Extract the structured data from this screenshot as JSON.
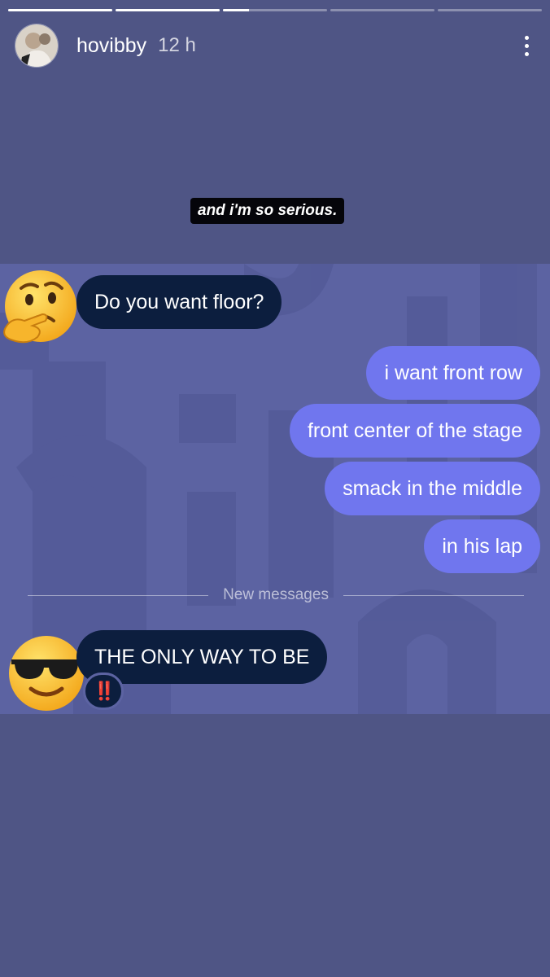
{
  "story": {
    "username": "hovibby",
    "time": "12 h",
    "progress": [
      1,
      1,
      0.25,
      0,
      0
    ]
  },
  "caption": "and i'm so serious.",
  "messages": {
    "incoming_1": "Do you want floor?",
    "outgoing": [
      "i want front row",
      "front center of the stage",
      "smack in the middle",
      "in his lap"
    ],
    "divider_label": "New messages",
    "incoming_2": "THE ONLY WAY TO BE",
    "reaction": "‼️"
  },
  "icons": {
    "menu": "more-vertical-icon",
    "emoji_1": "thinking-face-icon",
    "emoji_2": "sunglasses-face-icon"
  },
  "colors": {
    "background": "#4f5585",
    "panel": "#5c63a2",
    "incoming_bubble": "#0c1e3e",
    "outgoing_bubble": "#7076ee"
  }
}
